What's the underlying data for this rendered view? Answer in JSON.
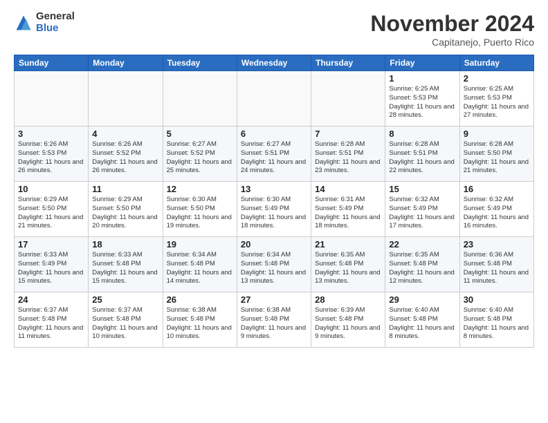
{
  "logo": {
    "general": "General",
    "blue": "Blue"
  },
  "header": {
    "month": "November 2024",
    "location": "Capitanejo, Puerto Rico"
  },
  "weekdays": [
    "Sunday",
    "Monday",
    "Tuesday",
    "Wednesday",
    "Thursday",
    "Friday",
    "Saturday"
  ],
  "weeks": [
    [
      {
        "day": "",
        "info": ""
      },
      {
        "day": "",
        "info": ""
      },
      {
        "day": "",
        "info": ""
      },
      {
        "day": "",
        "info": ""
      },
      {
        "day": "",
        "info": ""
      },
      {
        "day": "1",
        "info": "Sunrise: 6:25 AM\nSunset: 5:53 PM\nDaylight: 11 hours and 28 minutes."
      },
      {
        "day": "2",
        "info": "Sunrise: 6:25 AM\nSunset: 5:53 PM\nDaylight: 11 hours and 27 minutes."
      }
    ],
    [
      {
        "day": "3",
        "info": "Sunrise: 6:26 AM\nSunset: 5:53 PM\nDaylight: 11 hours and 26 minutes."
      },
      {
        "day": "4",
        "info": "Sunrise: 6:26 AM\nSunset: 5:52 PM\nDaylight: 11 hours and 26 minutes."
      },
      {
        "day": "5",
        "info": "Sunrise: 6:27 AM\nSunset: 5:52 PM\nDaylight: 11 hours and 25 minutes."
      },
      {
        "day": "6",
        "info": "Sunrise: 6:27 AM\nSunset: 5:51 PM\nDaylight: 11 hours and 24 minutes."
      },
      {
        "day": "7",
        "info": "Sunrise: 6:28 AM\nSunset: 5:51 PM\nDaylight: 11 hours and 23 minutes."
      },
      {
        "day": "8",
        "info": "Sunrise: 6:28 AM\nSunset: 5:51 PM\nDaylight: 11 hours and 22 minutes."
      },
      {
        "day": "9",
        "info": "Sunrise: 6:28 AM\nSunset: 5:50 PM\nDaylight: 11 hours and 21 minutes."
      }
    ],
    [
      {
        "day": "10",
        "info": "Sunrise: 6:29 AM\nSunset: 5:50 PM\nDaylight: 11 hours and 21 minutes."
      },
      {
        "day": "11",
        "info": "Sunrise: 6:29 AM\nSunset: 5:50 PM\nDaylight: 11 hours and 20 minutes."
      },
      {
        "day": "12",
        "info": "Sunrise: 6:30 AM\nSunset: 5:50 PM\nDaylight: 11 hours and 19 minutes."
      },
      {
        "day": "13",
        "info": "Sunrise: 6:30 AM\nSunset: 5:49 PM\nDaylight: 11 hours and 18 minutes."
      },
      {
        "day": "14",
        "info": "Sunrise: 6:31 AM\nSunset: 5:49 PM\nDaylight: 11 hours and 18 minutes."
      },
      {
        "day": "15",
        "info": "Sunrise: 6:32 AM\nSunset: 5:49 PM\nDaylight: 11 hours and 17 minutes."
      },
      {
        "day": "16",
        "info": "Sunrise: 6:32 AM\nSunset: 5:49 PM\nDaylight: 11 hours and 16 minutes."
      }
    ],
    [
      {
        "day": "17",
        "info": "Sunrise: 6:33 AM\nSunset: 5:49 PM\nDaylight: 11 hours and 15 minutes."
      },
      {
        "day": "18",
        "info": "Sunrise: 6:33 AM\nSunset: 5:48 PM\nDaylight: 11 hours and 15 minutes."
      },
      {
        "day": "19",
        "info": "Sunrise: 6:34 AM\nSunset: 5:48 PM\nDaylight: 11 hours and 14 minutes."
      },
      {
        "day": "20",
        "info": "Sunrise: 6:34 AM\nSunset: 5:48 PM\nDaylight: 11 hours and 13 minutes."
      },
      {
        "day": "21",
        "info": "Sunrise: 6:35 AM\nSunset: 5:48 PM\nDaylight: 11 hours and 13 minutes."
      },
      {
        "day": "22",
        "info": "Sunrise: 6:35 AM\nSunset: 5:48 PM\nDaylight: 11 hours and 12 minutes."
      },
      {
        "day": "23",
        "info": "Sunrise: 6:36 AM\nSunset: 5:48 PM\nDaylight: 11 hours and 11 minutes."
      }
    ],
    [
      {
        "day": "24",
        "info": "Sunrise: 6:37 AM\nSunset: 5:48 PM\nDaylight: 11 hours and 11 minutes."
      },
      {
        "day": "25",
        "info": "Sunrise: 6:37 AM\nSunset: 5:48 PM\nDaylight: 11 hours and 10 minutes."
      },
      {
        "day": "26",
        "info": "Sunrise: 6:38 AM\nSunset: 5:48 PM\nDaylight: 11 hours and 10 minutes."
      },
      {
        "day": "27",
        "info": "Sunrise: 6:38 AM\nSunset: 5:48 PM\nDaylight: 11 hours and 9 minutes."
      },
      {
        "day": "28",
        "info": "Sunrise: 6:39 AM\nSunset: 5:48 PM\nDaylight: 11 hours and 9 minutes."
      },
      {
        "day": "29",
        "info": "Sunrise: 6:40 AM\nSunset: 5:48 PM\nDaylight: 11 hours and 8 minutes."
      },
      {
        "day": "30",
        "info": "Sunrise: 6:40 AM\nSunset: 5:48 PM\nDaylight: 11 hours and 8 minutes."
      }
    ]
  ]
}
